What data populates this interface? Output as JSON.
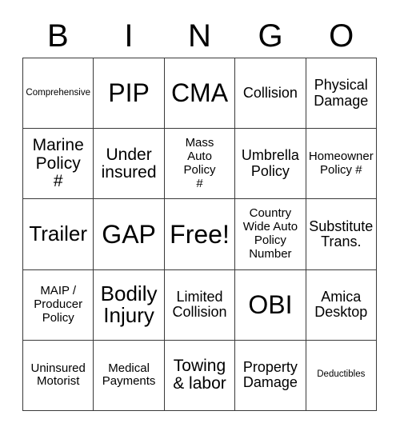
{
  "card": {
    "title": "Bingo Card",
    "header_letters": [
      "B",
      "I",
      "N",
      "G",
      "O"
    ],
    "grid_size": "5x5",
    "border_color": "#3a3a3a",
    "background_color": "#ffffff",
    "text_color": "#000000"
  },
  "rows": [
    {
      "cells": [
        {
          "text": "Comprehensive",
          "size": "xs"
        },
        {
          "text": "PIP",
          "size": "xxl"
        },
        {
          "text": "CMA",
          "size": "xxl"
        },
        {
          "text": "Collision",
          "size": "m"
        },
        {
          "text": "Physical\nDamage",
          "size": "m"
        }
      ]
    },
    {
      "cells": [
        {
          "text": "Marine\nPolicy\n#",
          "size": "l"
        },
        {
          "text": "Under\ninsured",
          "size": "l"
        },
        {
          "text": "Mass\nAuto\nPolicy\n#",
          "size": "s"
        },
        {
          "text": "Umbrella\nPolicy",
          "size": "m"
        },
        {
          "text": "Homeowner\nPolicy #",
          "size": "s"
        }
      ]
    },
    {
      "cells": [
        {
          "text": "Trailer",
          "size": "xl"
        },
        {
          "text": "GAP",
          "size": "xxl"
        },
        {
          "text": "Free!",
          "size": "xxl"
        },
        {
          "text": "Country\nWide Auto\nPolicy\nNumber",
          "size": "s"
        },
        {
          "text": "Substitute\nTrans.",
          "size": "m"
        }
      ]
    },
    {
      "cells": [
        {
          "text": "MAIP /\nProducer\nPolicy",
          "size": "s"
        },
        {
          "text": "Bodily\nInjury",
          "size": "xl"
        },
        {
          "text": "Limited\nCollision",
          "size": "m"
        },
        {
          "text": "OBI",
          "size": "xxl"
        },
        {
          "text": "Amica\nDesktop",
          "size": "m"
        }
      ]
    },
    {
      "cells": [
        {
          "text": "Uninsured\nMotorist",
          "size": "s"
        },
        {
          "text": "Medical\nPayments",
          "size": "s"
        },
        {
          "text": "Towing\n& labor",
          "size": "l"
        },
        {
          "text": "Property\nDamage",
          "size": "m"
        },
        {
          "text": "Deductibles",
          "size": "xs"
        }
      ]
    }
  ]
}
